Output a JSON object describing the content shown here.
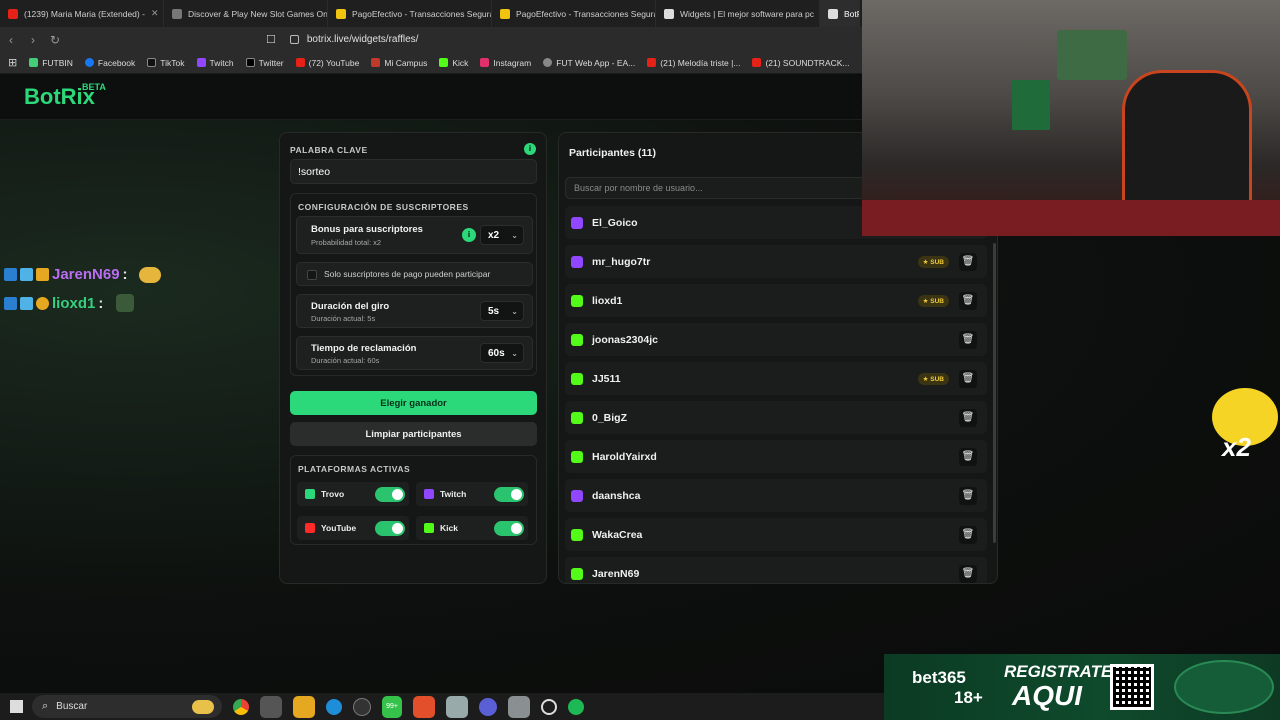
{
  "browser": {
    "tabs": [
      {
        "label": "(1239) Maria Maria (Extended) - "
      },
      {
        "label": "Discover & Play New Slot Games On"
      },
      {
        "label": "PagoEfectivo - Transacciones Segura"
      },
      {
        "label": "PagoEfectivo - Transacciones Segura"
      },
      {
        "label": "Widgets | El mejor software para pc"
      },
      {
        "label": "BotR"
      }
    ],
    "url": "botrix.live/widgets/raffles/",
    "bookmarks": [
      "FUTBIN",
      "Facebook",
      "TikTok",
      "Twitch",
      "Twitter",
      "(72) YouTube",
      "Mi Campus",
      "Kick",
      "Instagram",
      "FUT Web App - EA...",
      "(21) Melodía triste |...",
      "(21) SOUNDTRACK...",
      "(2"
    ]
  },
  "app": {
    "logo": "BotRix",
    "logo_badge": "BETA"
  },
  "chat": [
    {
      "user": "JarenN69",
      "sep": " :",
      "color": "#b96df0"
    },
    {
      "user": "lioxd1",
      "sep": " :",
      "color": "#35d07f"
    }
  ],
  "raffle": {
    "keyword_label": "PALABRA CLAVE",
    "keyword_value": "!sorteo",
    "subs_config_label": "CONFIGURACIÓN DE SUSCRIPTORES",
    "bonus_title": "Bonus para suscriptores",
    "bonus_sub": "Probabilidad total: x2",
    "bonus_value": "x2",
    "paid_only_label": "Solo suscriptores de pago pueden participar",
    "spin_title": "Duración del giro",
    "spin_sub": "Duración actual: 5s",
    "spin_value": "5s",
    "claim_title": "Tiempo de reclamación",
    "claim_sub": "Duración actual: 60s",
    "claim_value": "60s",
    "pick_winner": "Elegir ganador",
    "clear_participants": "Limpiar participantes",
    "platforms_label": "PLATAFORMAS ACTIVAS",
    "platforms": [
      {
        "name": "Trovo",
        "enabled": true,
        "color": "#2bd97a"
      },
      {
        "name": "Twitch",
        "enabled": true,
        "color": "#9146ff"
      },
      {
        "name": "YouTube",
        "enabled": true,
        "color": "#ff2a2a"
      },
      {
        "name": "Kick",
        "enabled": true,
        "color": "#53fc18"
      }
    ]
  },
  "participants": {
    "title": "Participantes (11)",
    "search_placeholder": "Buscar por nombre de usuario...",
    "sub_label": "SUB",
    "items": [
      {
        "name": "El_Goico",
        "platform": "twitch",
        "sub": false
      },
      {
        "name": "mr_hugo7tr",
        "platform": "twitch",
        "sub": true
      },
      {
        "name": "lioxd1",
        "platform": "kick",
        "sub": true
      },
      {
        "name": "joonas2304jc",
        "platform": "kick",
        "sub": false
      },
      {
        "name": "JJ511",
        "platform": "kick",
        "sub": true
      },
      {
        "name": "0_BigZ",
        "platform": "kick",
        "sub": false
      },
      {
        "name": "HaroldYairxd",
        "platform": "kick",
        "sub": false
      },
      {
        "name": "daanshca",
        "platform": "twitch",
        "sub": false
      },
      {
        "name": "WakaCrea",
        "platform": "kick",
        "sub": false
      },
      {
        "name": "JarenN69",
        "platform": "kick",
        "sub": false
      }
    ]
  },
  "overlay": {
    "multiplier": "x2",
    "ad_brand": "bet365",
    "ad_age": "18+",
    "ad_cta1": "REGISTRATE",
    "ad_cta2": "AQUI"
  },
  "taskbar": {
    "search_label": "Buscar",
    "badge": "99+"
  },
  "colors": {
    "accent": "#2bd97a",
    "twitch": "#9146ff",
    "kick": "#53fc18",
    "sub": "#f1cc3a"
  }
}
